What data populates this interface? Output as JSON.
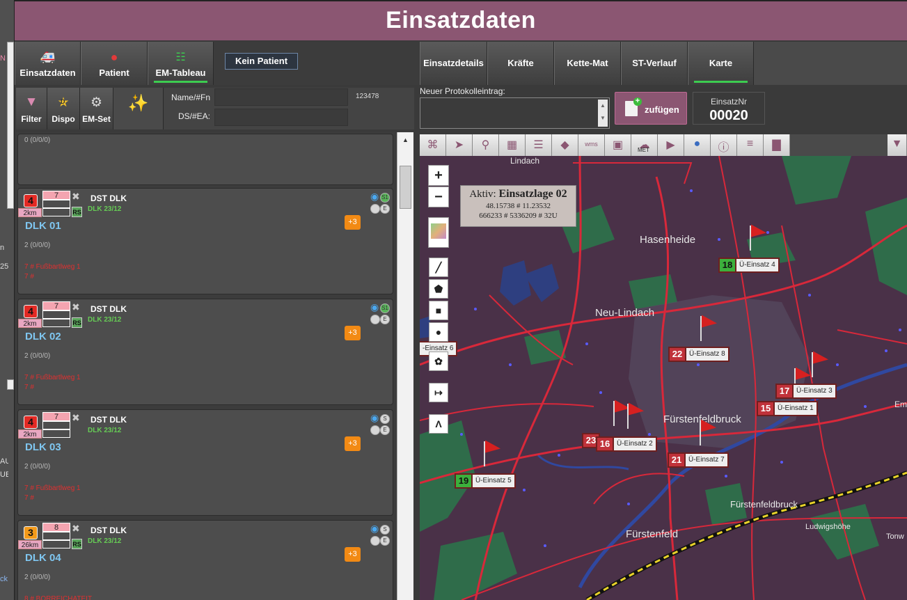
{
  "header": {
    "title": "Einsatzdaten"
  },
  "nav_left": [
    {
      "label": "Einsatzdaten",
      "icon": "ambulance-icon"
    },
    {
      "label": "Patient",
      "icon": "person-icon"
    },
    {
      "label": "EM-Tableau",
      "icon": "grid-icon",
      "active": true
    }
  ],
  "kein_patient": "Kein Patient",
  "nav_right": [
    {
      "label": "Einsatzdetails"
    },
    {
      "label": "Kräfte"
    },
    {
      "label": "Kette-Mat"
    },
    {
      "label": "ST-Verlauf"
    },
    {
      "label": "Karte",
      "active": true
    }
  ],
  "tools": {
    "filter": "Filter",
    "dispo": "Dispo",
    "dispo_letter": "D",
    "emset": "EM-Set",
    "name_label": "Name/#Fn",
    "ds_label": "DS/#EA:",
    "code": "123478"
  },
  "list": {
    "top_stat": "0  (0/0/0)",
    "cards": [
      {
        "num": "4",
        "num_color": "red",
        "box": "7",
        "km": "2km",
        "t1": "DST DLK",
        "t2": "DLK 23/12",
        "name": "DLK 01",
        "plus": "+3",
        "stat": "2  (0/0/0)",
        "addr1": "7 # Fußbartlweg 1",
        "addr2": "7 #",
        "c1": "S1",
        "c2": "E"
      },
      {
        "num": "4",
        "num_color": "red",
        "box": "7",
        "km": "2km",
        "t1": "DST DLK",
        "t2": "DLK 23/12",
        "name": "DLK 02",
        "plus": "+3",
        "stat": "2  (0/0/0)",
        "addr1": "7 # Fußbartlweg 1",
        "addr2": "7 #",
        "c1": "S1",
        "c2": "E"
      },
      {
        "num": "4",
        "num_color": "red",
        "box": "7",
        "km": "2km",
        "t1": "DST DLK",
        "t2": "DLK 23/12",
        "name": "DLK 03",
        "plus": "+3",
        "stat": "2  (0/0/0)",
        "addr1": "7 # Fußbartlweg 1",
        "addr2": "7 #",
        "c1": "S",
        "c2": "E"
      },
      {
        "num": "3",
        "num_color": "orange",
        "box": "8",
        "km": "26km",
        "t1": "DST DLK",
        "t2": "DLK 23/12",
        "name": "DLK 04",
        "plus": "+3",
        "stat": "2  (0/0/0)",
        "addr1": "8 # BORREICHATEIT",
        "addr2": "",
        "c1": "S",
        "c2": "E"
      }
    ]
  },
  "protocol": {
    "label": "Neuer Protokolleintrag:",
    "value": ""
  },
  "zufugen": "zufügen",
  "einsatznr": {
    "label": "EinsatzNr",
    "value": "00020"
  },
  "map_tools": [
    "network-icon",
    "pointer-icon",
    "search-icon",
    "film-icon",
    "document-icon",
    "layers-icon",
    "wms-icon",
    "camera-icon",
    "met-cloud-icon",
    "video-icon",
    "globe-icon",
    "info-icon",
    "hierarchy-icon",
    "bar-chart-icon"
  ],
  "map_tool_text": {
    "wms": "wms",
    "met": "MET"
  },
  "map": {
    "zoom_in": "+",
    "zoom_out": "−",
    "draw_tools": [
      "line-tool-icon",
      "polygon-tool-icon",
      "square-tool-icon",
      "circle-tool-icon",
      "color-wheel-icon",
      "arrow-right-icon",
      "caret-up-icon"
    ],
    "aktiv_prefix": "Aktiv:",
    "aktiv_title": "Einsatzlage 02",
    "coord1": "48.15738 # 11.23532",
    "coord2": "666233 # 5336209 # 32U",
    "places": [
      "Lindach",
      "Hasenheide",
      "Neu-Lindach",
      "Fürstenfeldbruck",
      "Fürstenfeldbruck",
      "Fürstenfeld",
      "Ludwigshöhe",
      "Tonw",
      "Em"
    ],
    "markers": [
      {
        "n": "18",
        "label": "Ü-Einsatz 4",
        "color": "green"
      },
      {
        "n": "22",
        "label": "Ü-Einsatz 8",
        "color": "red"
      },
      {
        "n": "17",
        "label": "Ü-Einsatz 3",
        "color": "red"
      },
      {
        "n": "15",
        "label": "Ü-Einsatz 1",
        "color": "red"
      },
      {
        "n": "23",
        "label": "",
        "color": "red"
      },
      {
        "n": "16",
        "label": "Ü-Einsatz 2",
        "color": "red"
      },
      {
        "n": "21",
        "label": "Ü-Einsatz 7",
        "color": "red"
      },
      {
        "n": "19",
        "label": "Ü-Einsatz 5",
        "color": "green"
      }
    ],
    "edge_marker": "-Einsatz 6"
  },
  "left_strip": [
    "N",
    "25",
    "n",
    "AU",
    "UE",
    "ck"
  ]
}
